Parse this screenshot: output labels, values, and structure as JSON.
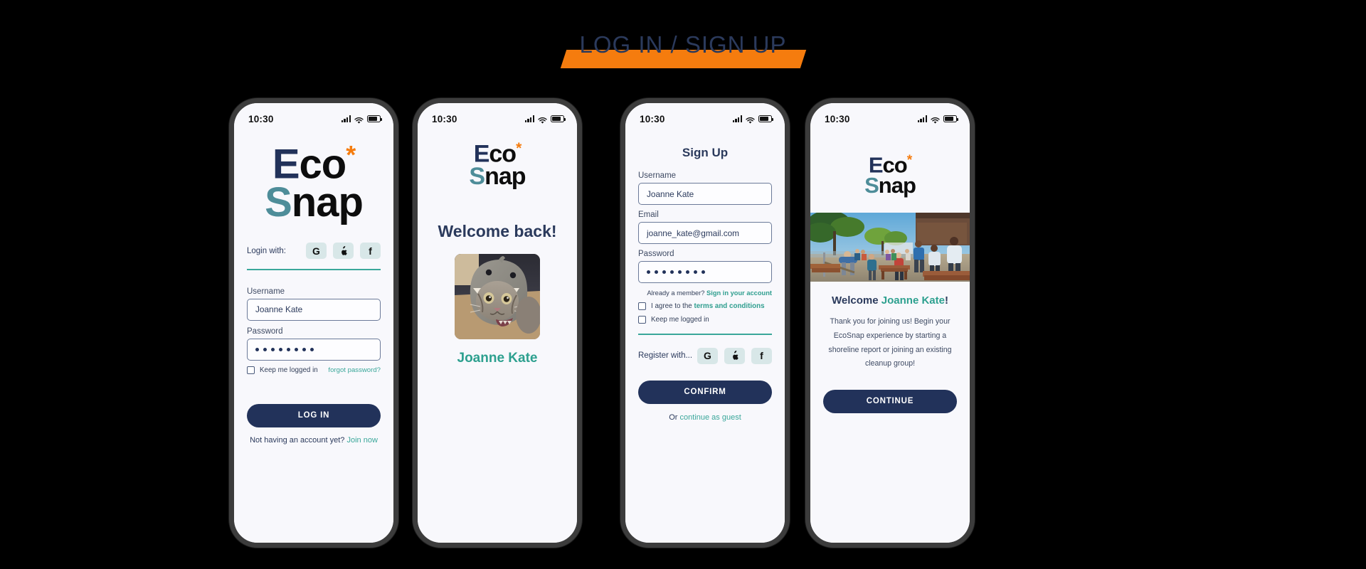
{
  "header": {
    "title": "LOG IN / SIGN UP",
    "highlight_color": "#f57c0e",
    "text_color": "#2b3a5c"
  },
  "brand": {
    "name": "EcoSnap",
    "part_e": "E",
    "part_co": "co",
    "part_star": "*",
    "part_s": "S",
    "part_nap": "nap",
    "navy": "#22325a",
    "teal": "#4e8d99",
    "orange": "#f57c0e"
  },
  "status_bar": {
    "time": "10:30",
    "signal": "signal-bars-icon",
    "wifi": "wifi-icon",
    "battery": "battery-icon"
  },
  "screens": {
    "login": {
      "social_prompt": "Login with:",
      "social": [
        {
          "name": "google",
          "glyph": "G"
        },
        {
          "name": "apple",
          "glyph": ""
        },
        {
          "name": "facebook",
          "glyph": "f"
        }
      ],
      "username_label": "Username",
      "username_value": "Joanne Kate",
      "username_placeholder": "Username",
      "password_label": "Password",
      "password_value": "••••••••",
      "password_dots": 8,
      "keep_logged_label": "Keep me logged in",
      "forgot_label": "forgot password?",
      "submit_label": "LOG IN",
      "footer_text": "Not having an account yet?",
      "footer_link": "Join now"
    },
    "welcome_back": {
      "heading": "Welcome back!",
      "avatar_alt": "cat-in-shark-hat-photo",
      "user_name": "Joanne Kate"
    },
    "signup": {
      "heading": "Sign Up",
      "username_label": "Username",
      "username_value": "Joanne Kate",
      "email_label": "Email",
      "email_value": "joanne_kate@gmail.com",
      "password_label": "Password",
      "password_dots": 8,
      "already_text": "Already a member?",
      "already_link": "Sign in your account",
      "terms_text": "I agree to the",
      "terms_link": "terms and conditions",
      "keep_logged_label": "Keep me logged in",
      "register_prompt": "Register with...",
      "social": [
        {
          "name": "google",
          "glyph": "G"
        },
        {
          "name": "apple",
          "glyph": ""
        },
        {
          "name": "facebook",
          "glyph": "f"
        }
      ],
      "submit_label": "CONFIRM",
      "guest_prefix": "Or",
      "guest_link": "continue as guest"
    },
    "onboarding": {
      "hero_alt": "community-shoreline-cleanup-photo",
      "welcome_prefix": "Welcome",
      "user_name": "Joanne Kate",
      "welcome_suffix": "!",
      "body": "Thank you for joining us! Begin your EcoSnap experience by starting a shoreline report or joining an existing cleanup group!",
      "submit_label": "CONTINUE"
    }
  },
  "colors": {
    "navy": "#22325a",
    "teal": "#3aa79a",
    "teal_bright": "#2da08f",
    "orange": "#f57c0e",
    "screen_bg": "#f8f8fc",
    "social_bg": "#d8e7e8"
  }
}
